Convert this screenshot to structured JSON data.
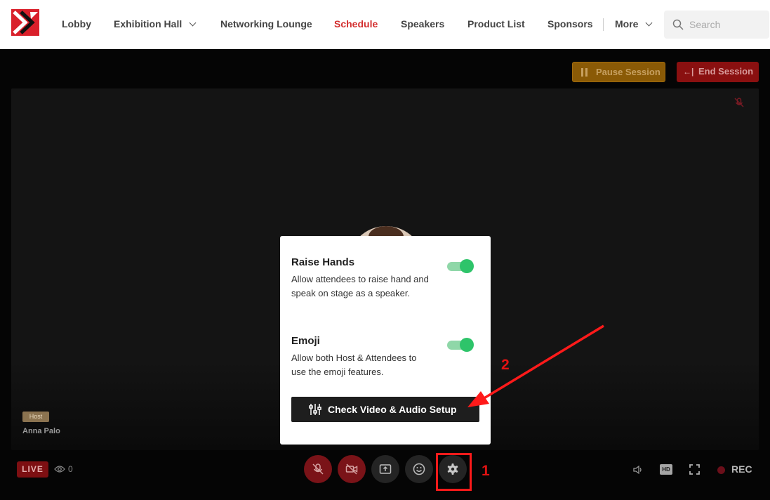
{
  "nav": {
    "items": [
      {
        "label": "Lobby"
      },
      {
        "label": "Exhibition Hall"
      },
      {
        "label": "Networking Lounge"
      },
      {
        "label": "Schedule"
      },
      {
        "label": "Speakers"
      },
      {
        "label": "Product List"
      },
      {
        "label": "Sponsors"
      },
      {
        "label": "More"
      }
    ],
    "active": "Schedule",
    "search_placeholder": "Search"
  },
  "session": {
    "pause_label": "Pause Session",
    "end_label": "End Session"
  },
  "speaker": {
    "badge": "Host",
    "name": "Anna Palo"
  },
  "controls": {
    "live_label": "LIVE",
    "viewer_count": "0",
    "hd_label": "HD",
    "rec_label": "REC"
  },
  "popup": {
    "raise_hands_title": "Raise Hands",
    "raise_hands_desc": "Allow attendees to raise hand and speak on stage as a speaker.",
    "raise_hands_on": true,
    "emoji_title": "Emoji",
    "emoji_desc": "Allow both Host & Attendees to use the emoji features.",
    "emoji_on": true,
    "check_button": "Check Video & Audio Setup"
  },
  "annotations": {
    "step1": "1",
    "step2": "2"
  },
  "colors": {
    "brand_red": "#d32f2f",
    "toggle_green": "#2ec46a",
    "annotation_red": "#e11212"
  },
  "icons": [
    "logo-icon",
    "chevron-down-icon",
    "search-icon",
    "pause-icon",
    "end-session-icon",
    "mic-off-icon",
    "video-off-icon",
    "share-screen-icon",
    "emoji-icon",
    "gear-icon",
    "eye-icon",
    "volume-icon",
    "fullscreen-icon",
    "sliders-icon"
  ]
}
